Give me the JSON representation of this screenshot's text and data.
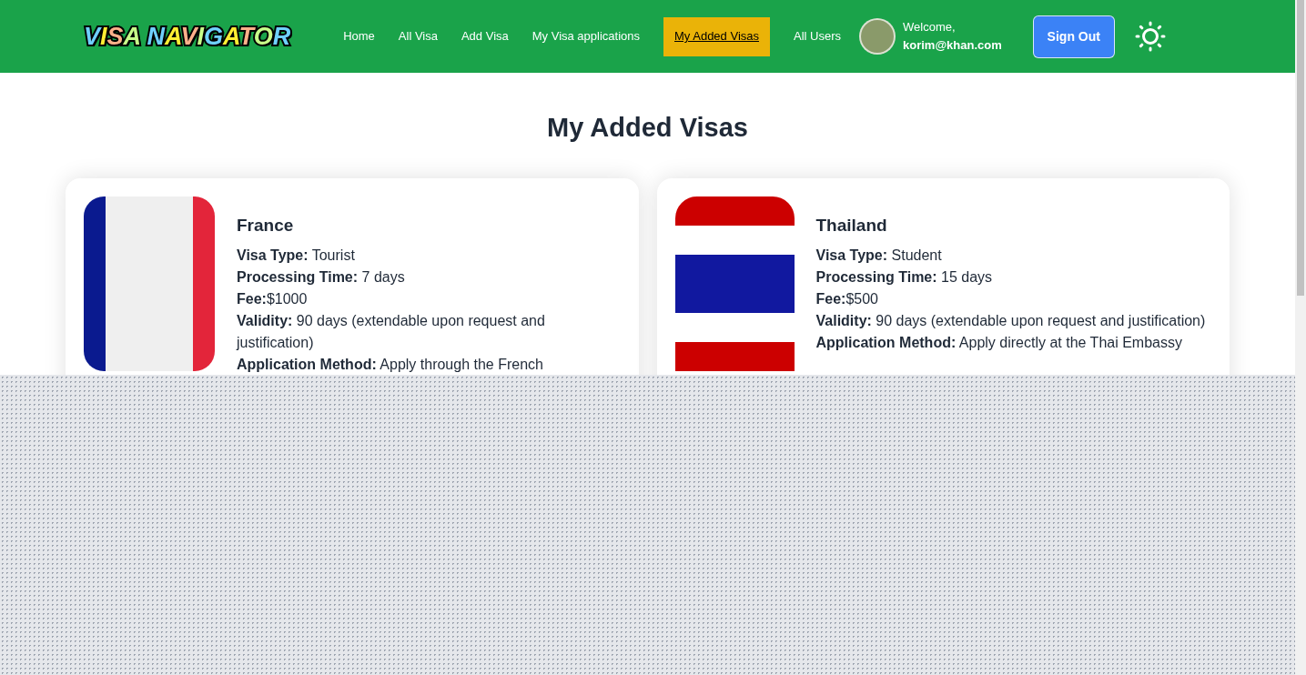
{
  "navbar": {
    "logo": "VISA NAVIGATOR",
    "links": [
      {
        "label": "Home",
        "selected": false
      },
      {
        "label": "All Visa",
        "selected": false
      },
      {
        "label": "Add Visa",
        "selected": false
      },
      {
        "label": "My Visa applications",
        "selected": false
      },
      {
        "label": "My Added Visas",
        "selected": true
      },
      {
        "label": "All Users",
        "selected": false
      }
    ],
    "welcome": "Welcome,",
    "email": "korim@khan.com",
    "sign_out": "Sign Out"
  },
  "page_title": "My Added Visas",
  "visas": [
    {
      "country": "France",
      "kind": "france",
      "fields": [
        "**Visa Type:** Tourist",
        "**Processing Time:** 7 days",
        "**Fee:**$1000",
        "**Validity:** 90 days (extendable upon request and justification)",
        "**Application Method:** Apply through the French"
      ]
    },
    {
      "country": "Thailand",
      "kind": "thailand",
      "fields": [
        "**Visa Type:** Student",
        "**Processing Time:** 15 days",
        "**Fee:**$500",
        "**Validity:** 90 days (extendable upon request and justification)",
        "**Application Method:** Apply directly at the Thai Embassy"
      ]
    }
  ]
}
